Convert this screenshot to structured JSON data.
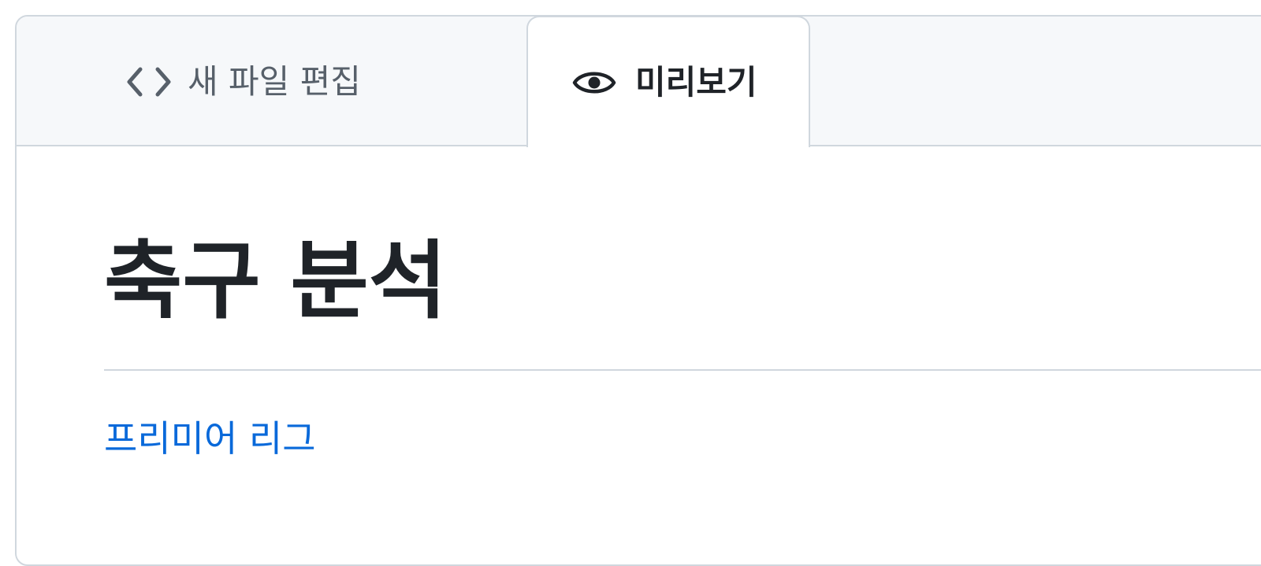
{
  "tabs": {
    "edit": {
      "label": "새 파일 편집",
      "icon": "code-icon"
    },
    "preview": {
      "label": "미리보기",
      "icon": "eye-icon",
      "active": true
    }
  },
  "document": {
    "title": "축구 분석",
    "link_text": "프리미어 리그"
  },
  "colors": {
    "border": "#d0d7de",
    "tabbar_bg": "#f6f8fa",
    "text": "#1f2328",
    "muted": "#57606a",
    "link": "#0969da"
  }
}
